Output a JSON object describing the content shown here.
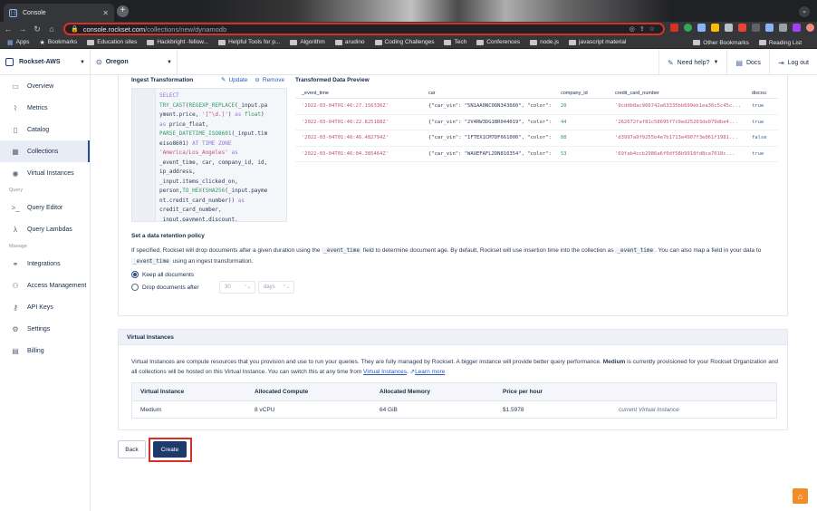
{
  "browser": {
    "tab_title": "Console",
    "url_host": "console.rockset.com",
    "url_path": "/collections/new/dynamodb",
    "bookmarks": [
      "Apps",
      "Bookmarks",
      "Education sites",
      "Hackbright -fellow...",
      "Helpful Tools for p...",
      "Algorithm",
      "arudino",
      "Coding Challenges",
      "Tech",
      "Conferences",
      "node.js",
      "javascript material"
    ],
    "other_bookmarks": "Other Bookmarks",
    "reading_list": "Reading List"
  },
  "header": {
    "org": "Rockset-AWS",
    "region": "Oregon",
    "need_help": "Need help?",
    "docs": "Docs",
    "logout": "Log out"
  },
  "sidebar": {
    "items": [
      {
        "label": "Overview",
        "icon": "monitor-icon"
      },
      {
        "label": "Metrics",
        "icon": "chart-icon"
      },
      {
        "label": "Catalog",
        "icon": "book-icon"
      },
      {
        "label": "Collections",
        "icon": "table-icon"
      },
      {
        "label": "Virtual Instances",
        "icon": "cpu-icon"
      }
    ],
    "query_section": "Query",
    "query_items": [
      {
        "label": "Query Editor",
        "icon": "terminal-icon"
      },
      {
        "label": "Query Lambdas",
        "icon": "lambda-icon"
      }
    ],
    "manage_section": "Manage",
    "manage_items": [
      {
        "label": "Integrations",
        "icon": "plug-icon"
      },
      {
        "label": "Access Management",
        "icon": "users-icon"
      },
      {
        "label": "API Keys",
        "icon": "key-icon"
      },
      {
        "label": "Settings",
        "icon": "gear-icon"
      },
      {
        "label": "Billing",
        "icon": "receipt-icon"
      }
    ]
  },
  "ingest": {
    "title": "Ingest Transformation",
    "update": "Update",
    "remove": "Remove",
    "preview_title": "Transformed Data Preview",
    "columns": [
      "_event_time",
      "car",
      "company_id",
      "credit_card_number",
      "discou"
    ],
    "rows": [
      [
        "'2022-03-04T01:46:27.156336Z'",
        "{\"car_vin\": \"5N1AA0NC0DN343660\", \"color\":",
        "20",
        "'9cddb0ac966742a63335bb699eb1ea36c5c45c...",
        "true"
      ],
      [
        "'2022-03-04T01:46:22.825188Z'",
        "{\"car_vin\": \"2V4RW3DG1BR044019\", \"color\":",
        "44",
        "'262672faf81c58695f7c9ed25203de079dbe4...",
        "true"
      ],
      [
        "'2022-03-04T01:46:46.482794Z'",
        "{\"car_vin\": \"1FTEX1CM7DF661000\", \"color\":",
        "88",
        "'d3997a9f9255b4e7b1713e4907f3e061f1981...",
        "false"
      ],
      [
        "'2022-03-04T01:46:04.385464Z'",
        "{\"car_vin\": \"WAUEFAFL2DN816354\", \"color\":",
        "53",
        "'69fab4ccb2986a6f0df58b9918fd8ca7018c...",
        "true"
      ]
    ]
  },
  "retention": {
    "title": "Set a data retention policy",
    "desc_1": "If specified, Rockset will drop documents after a given duration using the ",
    "code_1": "_event_time",
    "desc_2": " field to determine document age. By default, Rockset will use insertion time into the collection as ",
    "code_2": "_event_time",
    "desc_3": ". You can also map a field in your data to ",
    "code_3": "_event_time",
    "desc_4": " using an ingest transformation.",
    "keep_all": "Keep all documents",
    "drop_after": "Drop documents after",
    "duration_value": "30",
    "duration_unit": "days"
  },
  "virtual_instances": {
    "title": "Virtual Instances",
    "desc_1": "Virtual Instances are compute resources that you provision and use to run your queries. They are fully managed by Rockset. A bigger instance will provide better query performance. ",
    "desc_bold": "Medium",
    "desc_2": " is currently provisioned for your Rockset Organization and all collections will be hosted on this Virtual Instance. You can switch this at any time from ",
    "link_vi": "Virtual Instances",
    "desc_3": ". ",
    "learn_more": "Learn more",
    "columns": [
      "Virtual Instance",
      "Allocated Compute",
      "Allocated Memory",
      "Price per hour"
    ],
    "row": [
      "Medium",
      "8 vCPU",
      "64 GiB",
      "$1.5978",
      "current Virtual Instance"
    ]
  },
  "buttons": {
    "back": "Back",
    "create": "Create"
  }
}
